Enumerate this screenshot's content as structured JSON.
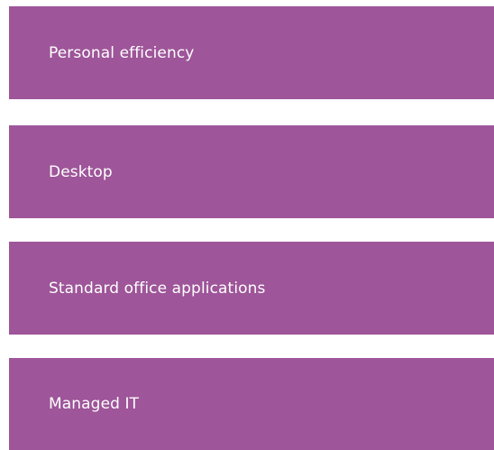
{
  "menu": {
    "items": [
      {
        "label": "Personal efficiency"
      },
      {
        "label": "Desktop"
      },
      {
        "label": "Standard office applications"
      },
      {
        "label": "Managed IT"
      }
    ]
  },
  "colors": {
    "tile_background": "#9e5599",
    "tile_text": "#ffffff"
  }
}
